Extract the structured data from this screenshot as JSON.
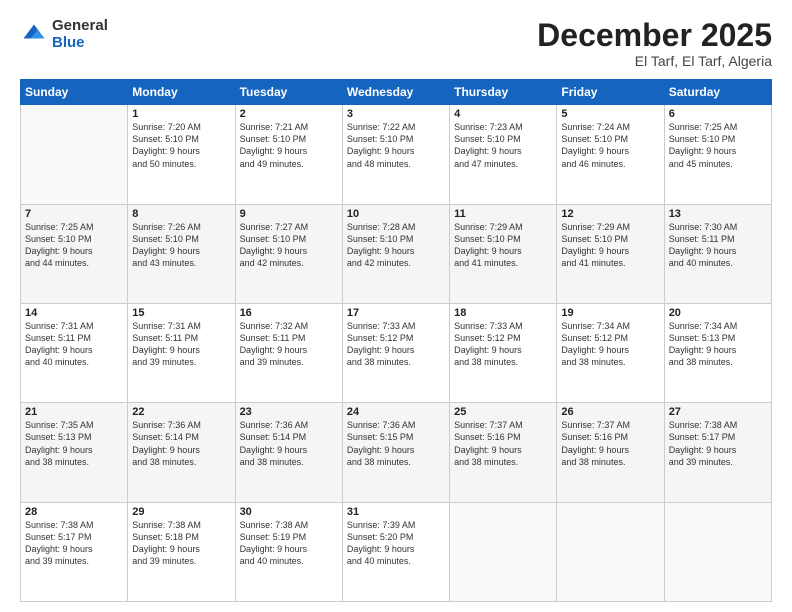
{
  "logo": {
    "general": "General",
    "blue": "Blue"
  },
  "header": {
    "title": "December 2025",
    "subtitle": "El Tarf, El Tarf, Algeria"
  },
  "weekdays": [
    "Sunday",
    "Monday",
    "Tuesday",
    "Wednesday",
    "Thursday",
    "Friday",
    "Saturday"
  ],
  "weeks": [
    [
      {
        "day": "",
        "info": ""
      },
      {
        "day": "1",
        "info": "Sunrise: 7:20 AM\nSunset: 5:10 PM\nDaylight: 9 hours\nand 50 minutes."
      },
      {
        "day": "2",
        "info": "Sunrise: 7:21 AM\nSunset: 5:10 PM\nDaylight: 9 hours\nand 49 minutes."
      },
      {
        "day": "3",
        "info": "Sunrise: 7:22 AM\nSunset: 5:10 PM\nDaylight: 9 hours\nand 48 minutes."
      },
      {
        "day": "4",
        "info": "Sunrise: 7:23 AM\nSunset: 5:10 PM\nDaylight: 9 hours\nand 47 minutes."
      },
      {
        "day": "5",
        "info": "Sunrise: 7:24 AM\nSunset: 5:10 PM\nDaylight: 9 hours\nand 46 minutes."
      },
      {
        "day": "6",
        "info": "Sunrise: 7:25 AM\nSunset: 5:10 PM\nDaylight: 9 hours\nand 45 minutes."
      }
    ],
    [
      {
        "day": "7",
        "info": "Sunrise: 7:25 AM\nSunset: 5:10 PM\nDaylight: 9 hours\nand 44 minutes."
      },
      {
        "day": "8",
        "info": "Sunrise: 7:26 AM\nSunset: 5:10 PM\nDaylight: 9 hours\nand 43 minutes."
      },
      {
        "day": "9",
        "info": "Sunrise: 7:27 AM\nSunset: 5:10 PM\nDaylight: 9 hours\nand 42 minutes."
      },
      {
        "day": "10",
        "info": "Sunrise: 7:28 AM\nSunset: 5:10 PM\nDaylight: 9 hours\nand 42 minutes."
      },
      {
        "day": "11",
        "info": "Sunrise: 7:29 AM\nSunset: 5:10 PM\nDaylight: 9 hours\nand 41 minutes."
      },
      {
        "day": "12",
        "info": "Sunrise: 7:29 AM\nSunset: 5:10 PM\nDaylight: 9 hours\nand 41 minutes."
      },
      {
        "day": "13",
        "info": "Sunrise: 7:30 AM\nSunset: 5:11 PM\nDaylight: 9 hours\nand 40 minutes."
      }
    ],
    [
      {
        "day": "14",
        "info": "Sunrise: 7:31 AM\nSunset: 5:11 PM\nDaylight: 9 hours\nand 40 minutes."
      },
      {
        "day": "15",
        "info": "Sunrise: 7:31 AM\nSunset: 5:11 PM\nDaylight: 9 hours\nand 39 minutes."
      },
      {
        "day": "16",
        "info": "Sunrise: 7:32 AM\nSunset: 5:11 PM\nDaylight: 9 hours\nand 39 minutes."
      },
      {
        "day": "17",
        "info": "Sunrise: 7:33 AM\nSunset: 5:12 PM\nDaylight: 9 hours\nand 38 minutes."
      },
      {
        "day": "18",
        "info": "Sunrise: 7:33 AM\nSunset: 5:12 PM\nDaylight: 9 hours\nand 38 minutes."
      },
      {
        "day": "19",
        "info": "Sunrise: 7:34 AM\nSunset: 5:12 PM\nDaylight: 9 hours\nand 38 minutes."
      },
      {
        "day": "20",
        "info": "Sunrise: 7:34 AM\nSunset: 5:13 PM\nDaylight: 9 hours\nand 38 minutes."
      }
    ],
    [
      {
        "day": "21",
        "info": "Sunrise: 7:35 AM\nSunset: 5:13 PM\nDaylight: 9 hours\nand 38 minutes."
      },
      {
        "day": "22",
        "info": "Sunrise: 7:36 AM\nSunset: 5:14 PM\nDaylight: 9 hours\nand 38 minutes."
      },
      {
        "day": "23",
        "info": "Sunrise: 7:36 AM\nSunset: 5:14 PM\nDaylight: 9 hours\nand 38 minutes."
      },
      {
        "day": "24",
        "info": "Sunrise: 7:36 AM\nSunset: 5:15 PM\nDaylight: 9 hours\nand 38 minutes."
      },
      {
        "day": "25",
        "info": "Sunrise: 7:37 AM\nSunset: 5:16 PM\nDaylight: 9 hours\nand 38 minutes."
      },
      {
        "day": "26",
        "info": "Sunrise: 7:37 AM\nSunset: 5:16 PM\nDaylight: 9 hours\nand 38 minutes."
      },
      {
        "day": "27",
        "info": "Sunrise: 7:38 AM\nSunset: 5:17 PM\nDaylight: 9 hours\nand 39 minutes."
      }
    ],
    [
      {
        "day": "28",
        "info": "Sunrise: 7:38 AM\nSunset: 5:17 PM\nDaylight: 9 hours\nand 39 minutes."
      },
      {
        "day": "29",
        "info": "Sunrise: 7:38 AM\nSunset: 5:18 PM\nDaylight: 9 hours\nand 39 minutes."
      },
      {
        "day": "30",
        "info": "Sunrise: 7:38 AM\nSunset: 5:19 PM\nDaylight: 9 hours\nand 40 minutes."
      },
      {
        "day": "31",
        "info": "Sunrise: 7:39 AM\nSunset: 5:20 PM\nDaylight: 9 hours\nand 40 minutes."
      },
      {
        "day": "",
        "info": ""
      },
      {
        "day": "",
        "info": ""
      },
      {
        "day": "",
        "info": ""
      }
    ]
  ]
}
